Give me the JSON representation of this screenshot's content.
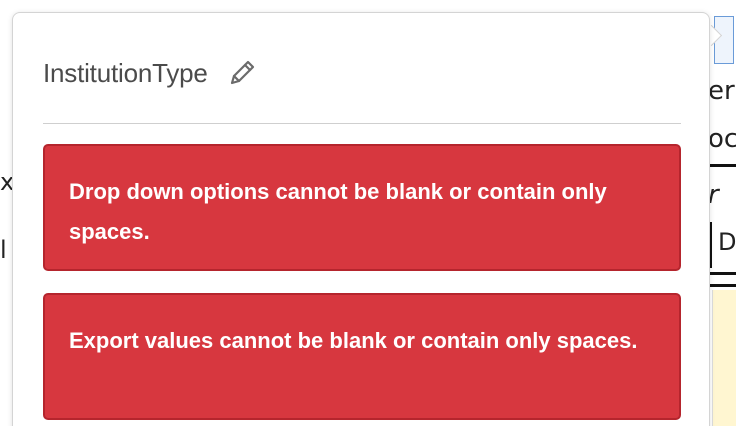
{
  "popover": {
    "field_name": "InstitutionType",
    "edit_icon": "pencil-icon",
    "errors": [
      {
        "message": "Drop down options cannot be blank or contain only spaces."
      },
      {
        "message": "Export values cannot be blank or contain only spaces."
      }
    ]
  },
  "background_doc": {
    "fragments": [
      "er",
      "oc",
      "r",
      "D"
    ],
    "left_fragments": [
      "x",
      "l"
    ]
  },
  "colors": {
    "error_bg": "#d7373f",
    "error_border": "#b5252d",
    "field_text": "#4b4b4b",
    "highlight_bg": "#fff6d1"
  }
}
